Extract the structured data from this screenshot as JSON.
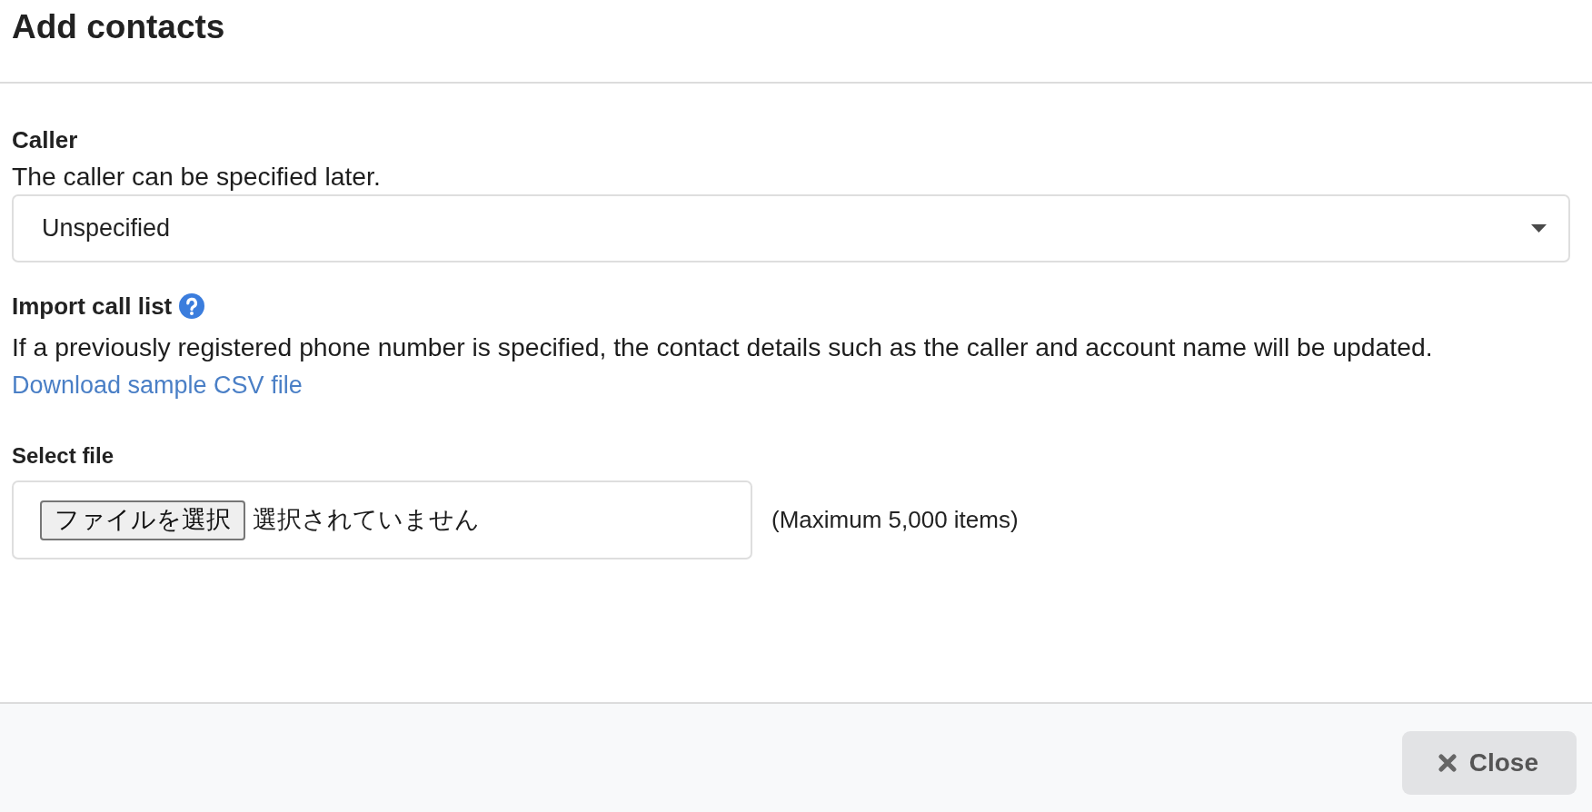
{
  "dialog": {
    "title": "Add contacts"
  },
  "caller": {
    "label": "Caller",
    "description": "The caller can be specified later.",
    "select": {
      "value": "Unspecified"
    }
  },
  "import": {
    "label": "Import call list",
    "help": true,
    "description": "If a previously registered phone number is specified, the contact details such as the caller and account name will be updated.",
    "link": "Download sample CSV file"
  },
  "file": {
    "label": "Select file",
    "button": "ファイルを選択",
    "status": "選択されていません",
    "note": "(Maximum 5,000 items)"
  },
  "footer": {
    "buttons": [
      {
        "label": "Close",
        "kind": "close"
      }
    ]
  }
}
